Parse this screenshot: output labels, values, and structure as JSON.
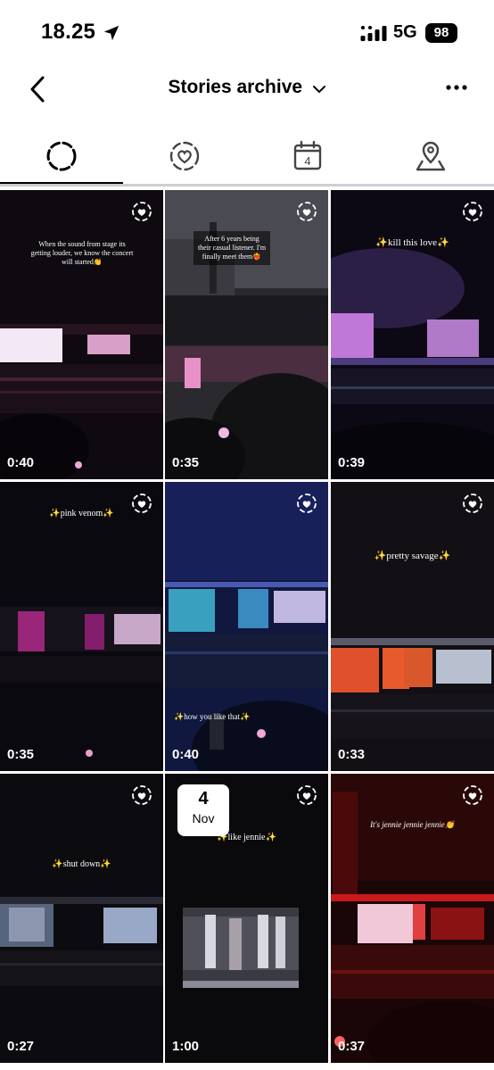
{
  "status_bar": {
    "time": "18.25",
    "network": "5G",
    "battery": "98"
  },
  "header": {
    "title": "Stories archive"
  },
  "tabs": [
    {
      "id": "stories",
      "icon": "dashed-circle-icon",
      "active": true
    },
    {
      "id": "highlights",
      "icon": "heart-circle-icon",
      "active": false
    },
    {
      "id": "calendar",
      "icon": "calendar-icon",
      "label": "4",
      "active": false
    },
    {
      "id": "map",
      "icon": "map-pin-icon",
      "active": false
    }
  ],
  "stories": [
    {
      "duration": "0:40",
      "caption": "When the sound from stage its getting louder, we know the concert will started👏"
    },
    {
      "duration": "0:35",
      "caption": "After 6 years being their casual listener. I'm finally meet them❤️‍🔥"
    },
    {
      "duration": "0:39",
      "caption": "✨kill this love✨"
    },
    {
      "duration": "0:35",
      "caption": "✨pink venom✨"
    },
    {
      "duration": "0:40",
      "caption": "✨how you like that✨"
    },
    {
      "duration": "0:33",
      "caption": "✨pretty savage✨"
    },
    {
      "duration": "0:27",
      "caption": "✨shut down✨"
    },
    {
      "duration": "1:00",
      "caption": "✨like jennie✨",
      "date_day": "4",
      "date_month": "Nov"
    },
    {
      "duration": "0:37",
      "caption": "It's jennie jennie jennie👏"
    }
  ],
  "colors": {
    "accent": "#000000",
    "background": "#ffffff"
  }
}
